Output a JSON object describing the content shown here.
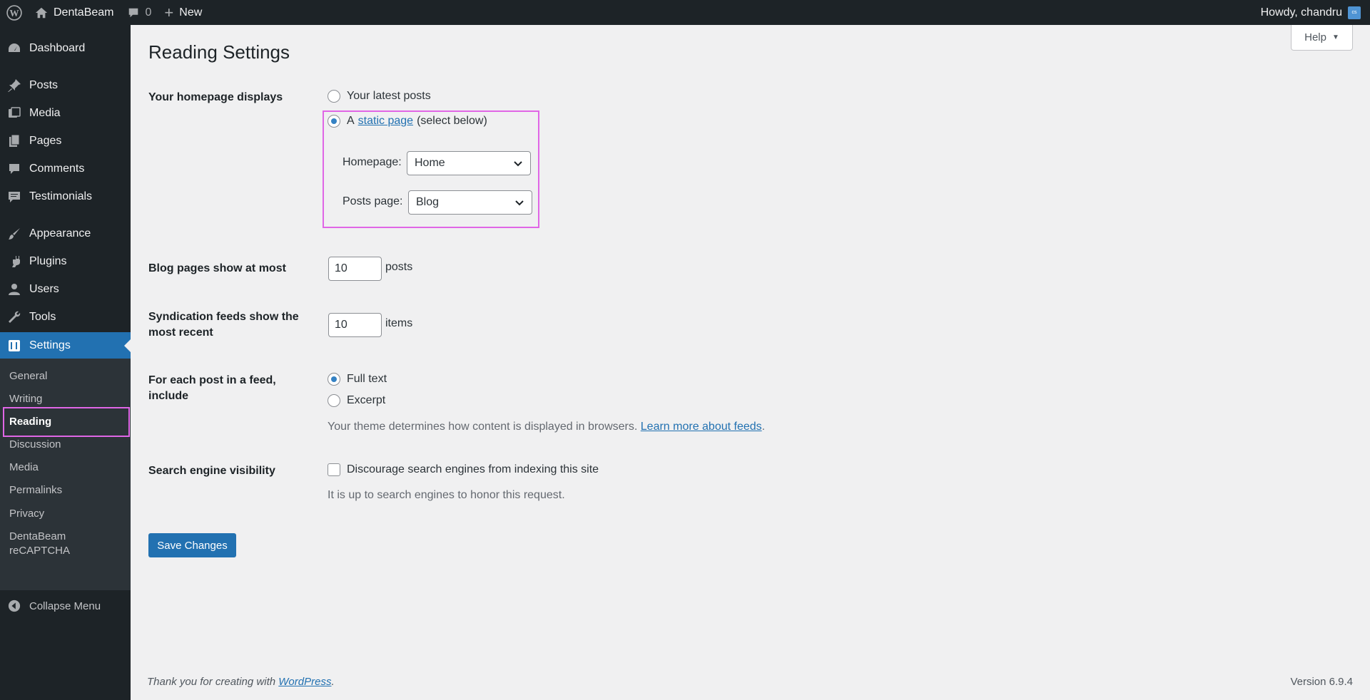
{
  "adminbar": {
    "site_name": "DentaBeam",
    "comments_count": "0",
    "new_label": "New",
    "howdy": "Howdy, chandru",
    "avatar_initials": "cs"
  },
  "sidebar": {
    "items": [
      {
        "label": "Dashboard",
        "icon": "dashboard-icon"
      },
      {
        "label": "Posts",
        "icon": "pin-icon"
      },
      {
        "label": "Media",
        "icon": "media-icon"
      },
      {
        "label": "Pages",
        "icon": "pages-icon"
      },
      {
        "label": "Comments",
        "icon": "comment-icon"
      },
      {
        "label": "Testimonials",
        "icon": "testimonial-icon"
      },
      {
        "label": "Appearance",
        "icon": "brush-icon"
      },
      {
        "label": "Plugins",
        "icon": "plugin-icon"
      },
      {
        "label": "Users",
        "icon": "user-icon"
      },
      {
        "label": "Tools",
        "icon": "wrench-icon"
      },
      {
        "label": "Settings",
        "icon": "settings-icon"
      }
    ],
    "submenu": [
      "General",
      "Writing",
      "Reading",
      "Discussion",
      "Media",
      "Permalinks",
      "Privacy",
      "DentaBeam",
      "reCAPTCHA"
    ],
    "collapse_label": "Collapse Menu"
  },
  "page": {
    "title": "Reading Settings",
    "help_label": "Help",
    "homepage_displays": {
      "label": "Your homepage displays",
      "option_latest": "Your latest posts",
      "option_static_prefix": "A",
      "option_static_link": "static page",
      "option_static_suffix": "(select below)",
      "homepage_label": "Homepage:",
      "homepage_value": "Home",
      "posts_page_label": "Posts page:",
      "posts_page_value": "Blog"
    },
    "blog_pages": {
      "label": "Blog pages show at most",
      "value": "10",
      "unit": "posts"
    },
    "syndication": {
      "label_line1": "Syndication feeds show the",
      "label_line2": "most recent",
      "value": "10",
      "unit": "items"
    },
    "feed_include": {
      "label_line1": "For each post in a feed,",
      "label_line2": "include",
      "option_full": "Full text",
      "option_excerpt": "Excerpt",
      "desc": "Your theme determines how content is displayed in browsers.",
      "desc_link": "Learn more about feeds",
      "desc_end": "."
    },
    "search_visibility": {
      "label": "Search engine visibility",
      "checkbox_label": "Discourage search engines from indexing this site",
      "desc": "It is up to search engines to honor this request."
    },
    "save_label": "Save Changes"
  },
  "footer": {
    "thanks_prefix": "Thank you for creating with",
    "thanks_link": "WordPress",
    "thanks_suffix": ".",
    "version": "Version 6.9.4"
  }
}
